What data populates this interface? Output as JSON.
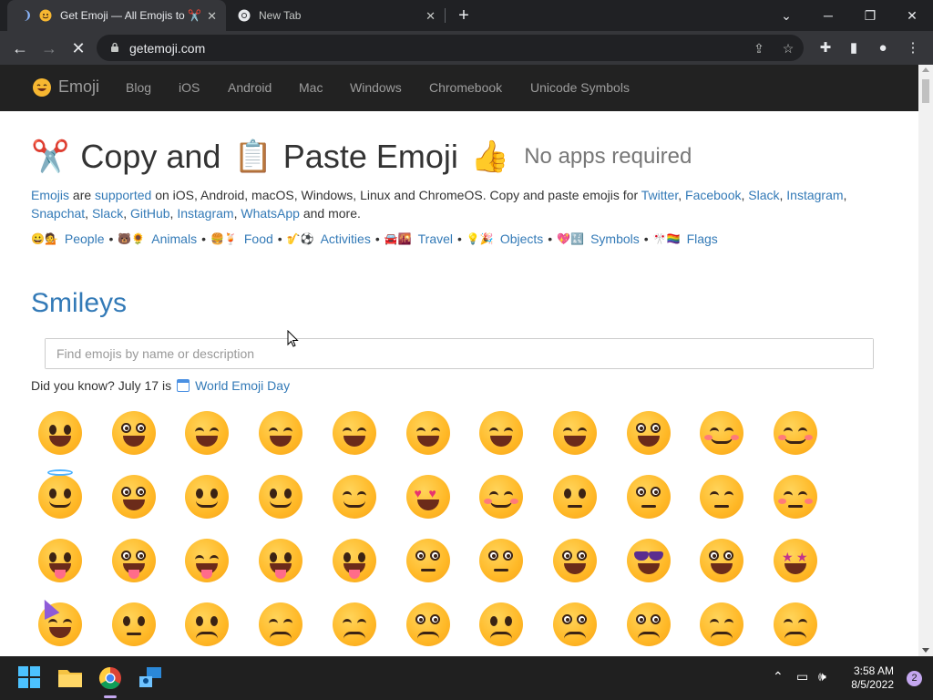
{
  "browser": {
    "tabs": [
      {
        "title": "Get Emoji — All Emojis to ✂️",
        "active": true
      },
      {
        "title": "New Tab",
        "active": false
      }
    ],
    "url": "getemoji.com"
  },
  "site": {
    "brand": "Emoji",
    "nav": [
      "Blog",
      "iOS",
      "Android",
      "Mac",
      "Windows",
      "Chromebook",
      "Unicode Symbols"
    ],
    "hero": {
      "emoji1": "✂️",
      "text1": "Copy and",
      "emoji2": "📋",
      "text2": "Paste Emoji",
      "emoji3": "👍",
      "subtitle": "No apps required"
    },
    "description": {
      "link_emojis": "Emojis",
      "t1": " are ",
      "link_supported": "supported",
      "t2": " on iOS, Android, macOS, Windows, Linux and ChromeOS. Copy and paste emojis for ",
      "links": [
        "Twitter",
        "Facebook",
        "Slack",
        "Instagram",
        "Snapchat",
        "Slack",
        "GitHub",
        "Instagram",
        "WhatsApp"
      ],
      "t3": " and more."
    },
    "categories": [
      {
        "emojis": "😀💁",
        "label": "People"
      },
      {
        "emojis": "🐻🌻",
        "label": "Animals"
      },
      {
        "emojis": "🍔🍹",
        "label": "Food"
      },
      {
        "emojis": "🎷⚽️",
        "label": "Activities"
      },
      {
        "emojis": "🚘🌇",
        "label": "Travel"
      },
      {
        "emojis": "💡🎉",
        "label": "Objects"
      },
      {
        "emojis": "💖🔣",
        "label": "Symbols"
      },
      {
        "emojis": "🎌🏳️‍🌈",
        "label": "Flags"
      }
    ],
    "section_title": "Smileys",
    "search": {
      "placeholder": "Find emojis by name or description",
      "value": ""
    },
    "did_you_know": {
      "text": "Did you know? July 17 is",
      "link": "World Emoji Day"
    }
  },
  "emoji_grid": [
    [
      "grinning",
      "smiley",
      "smile",
      "grin",
      "laughing",
      "sweat-smile",
      "joy",
      "rofl",
      "tear-smile",
      "relaxed",
      "blush"
    ],
    [
      "innocent",
      "slight-smile",
      "upside-down",
      "wink",
      "relieved",
      "heart-eyes",
      "smiling-hearts",
      "kissing-heart",
      "kissing",
      "kissing-smiling",
      "kissing-closed"
    ],
    [
      "yum",
      "tongue",
      "squint-tongue",
      "wink-tongue",
      "zany",
      "raised-brow",
      "monocle",
      "nerd",
      "sunglasses",
      "disguised",
      "star-struck"
    ],
    [
      "partying",
      "smirk",
      "unamused",
      "disappointed",
      "pensive",
      "worried",
      "confused",
      "slight-frown",
      "frowning",
      "persevere",
      "confounded"
    ]
  ],
  "taskbar": {
    "time": "3:58 AM",
    "date": "8/5/2022",
    "notifications": "2"
  },
  "colors": {
    "link": "#337ab7",
    "navbar": "#222222",
    "chrome_dark": "#202124",
    "chrome_toolbar": "#35363a"
  }
}
